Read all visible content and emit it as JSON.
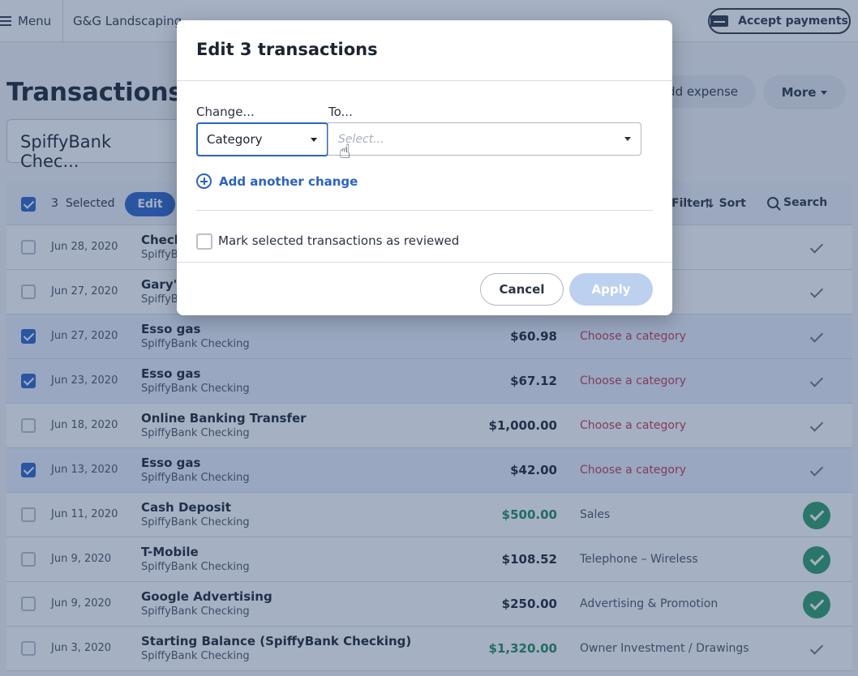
{
  "topbar": {
    "menu_label": "Menu",
    "company_name": "G&G Landscaping",
    "accept_payments_label": "Accept payments"
  },
  "page": {
    "title": "Transactions",
    "add_expense_label": "Add expense",
    "more_label": "More",
    "account_selected": "SpiffyBank Chec..."
  },
  "table_toolbar": {
    "selected_count": "3",
    "selected_label": "Selected",
    "edit_label": "Edit",
    "filter_label": "Filter",
    "sort_label": "Sort",
    "search_label": "Search"
  },
  "transactions": [
    {
      "date": "Jun 28, 2020",
      "payee": "Check",
      "account": "SpiffyBank Checking",
      "amount": "",
      "category": "",
      "selected": false,
      "reviewed": false
    },
    {
      "date": "Jun 27, 2020",
      "payee": "Gary's",
      "account": "SpiffyBank Checking",
      "amount": "",
      "category": "",
      "selected": false,
      "reviewed": false
    },
    {
      "date": "Jun 27, 2020",
      "payee": "Esso gas",
      "account": "SpiffyBank Checking",
      "amount": "$60.98",
      "category": "Choose a category",
      "selected": true,
      "reviewed": false
    },
    {
      "date": "Jun 23, 2020",
      "payee": "Esso gas",
      "account": "SpiffyBank Checking",
      "amount": "$67.12",
      "category": "Choose a category",
      "selected": true,
      "reviewed": false
    },
    {
      "date": "Jun 18, 2020",
      "payee": "Online Banking Transfer",
      "account": "SpiffyBank Checking",
      "amount": "$1,000.00",
      "category": "Choose a category",
      "selected": false,
      "reviewed": false
    },
    {
      "date": "Jun 13, 2020",
      "payee": "Esso gas",
      "account": "SpiffyBank Checking",
      "amount": "$42.00",
      "category": "Choose a category",
      "selected": true,
      "reviewed": false
    },
    {
      "date": "Jun 11, 2020",
      "payee": "Cash Deposit",
      "account": "SpiffyBank Checking",
      "amount": "$500.00",
      "category": "Sales",
      "selected": false,
      "reviewed": true
    },
    {
      "date": "Jun 9, 2020",
      "payee": "T-Mobile",
      "account": "SpiffyBank Checking",
      "amount": "$108.52",
      "category": "Telephone – Wireless",
      "selected": false,
      "reviewed": true
    },
    {
      "date": "Jun 9, 2020",
      "payee": "Google Advertising",
      "account": "SpiffyBank Checking",
      "amount": "$250.00",
      "category": "Advertising & Promotion",
      "selected": false,
      "reviewed": true
    },
    {
      "date": "Jun 3, 2020",
      "payee": "Starting Balance (SpiffyBank Checking)",
      "account": "SpiffyBank Checking",
      "amount": "$1,320.00",
      "category": "Owner Investment / Drawings",
      "selected": false,
      "reviewed": false
    }
  ],
  "modal": {
    "title": "Edit 3 transactions",
    "change_label": "Change...",
    "to_label": "To...",
    "change_value": "Category",
    "to_placeholder": "Select...",
    "add_change_label": "Add another change",
    "mark_reviewed_label": "Mark selected transactions as reviewed",
    "cancel_label": "Cancel",
    "apply_label": "Apply"
  },
  "colors": {
    "accent": "#2b63c6",
    "needs_category": "#c23a4f",
    "income": "#1f8a5a",
    "reviewed_badge": "#2d9c68"
  },
  "icons": [
    "hamburger-icon",
    "credit-card-icon",
    "caret-down-icon",
    "sort-icon",
    "search-icon",
    "checkmark-icon",
    "plus-circle-icon",
    "hand-cursor-icon"
  ]
}
